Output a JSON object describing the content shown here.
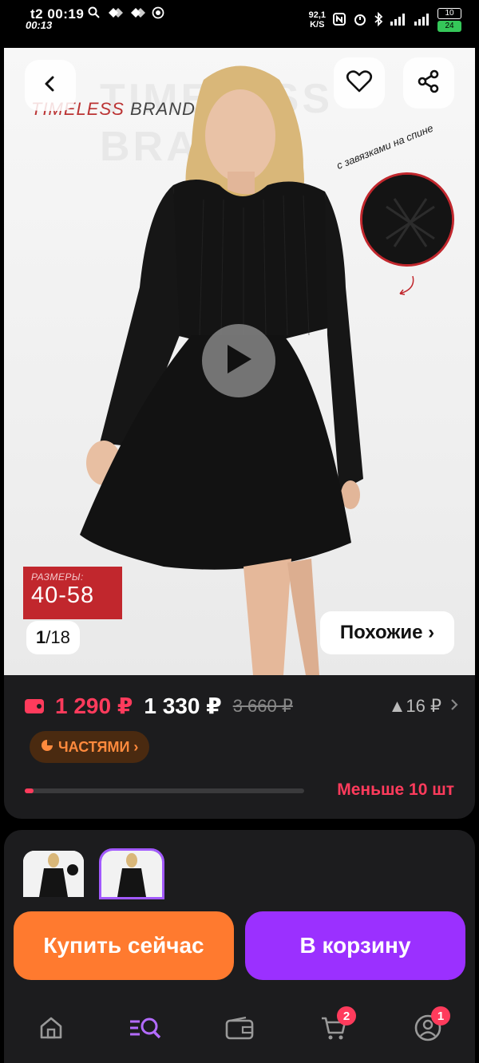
{
  "status_bar": {
    "time": "t2 00:19",
    "time_secondary": "00:13",
    "net_speed": "92,1",
    "net_speed_unit": "K/S",
    "battery_top": "10",
    "battery_bottom": "24"
  },
  "product": {
    "brand_word1": "TIMELESS",
    "brand_word2": "BRAND",
    "watermark": "TIMELESS BRAND",
    "feature_caption": "с завязками на спине",
    "sizes_label": "РАЗМЕРЫ:",
    "sizes_range": "40-58",
    "image_index": "1",
    "image_total": "18",
    "similar_label": "Похожие ›"
  },
  "pricing": {
    "price_wallet": "1 290 ₽",
    "price_regular": "1 330 ₽",
    "price_old": "3 660 ₽",
    "price_delta": "▲16 ₽",
    "installment_label": "ЧАСТЯМИ ›",
    "stock_text": "Меньше 10 шт",
    "stock_level": 0.03
  },
  "actions": {
    "buy_now": "Купить сейчас",
    "add_to_cart": "В корзину"
  },
  "nav": {
    "cart_badge": "2",
    "profile_badge": "1"
  },
  "colors": {
    "accent_red": "#ff3b5c",
    "buy_orange": "#ff7a2f",
    "cart_purple": "#9b30ff",
    "size_badge_red": "#c1272d"
  }
}
